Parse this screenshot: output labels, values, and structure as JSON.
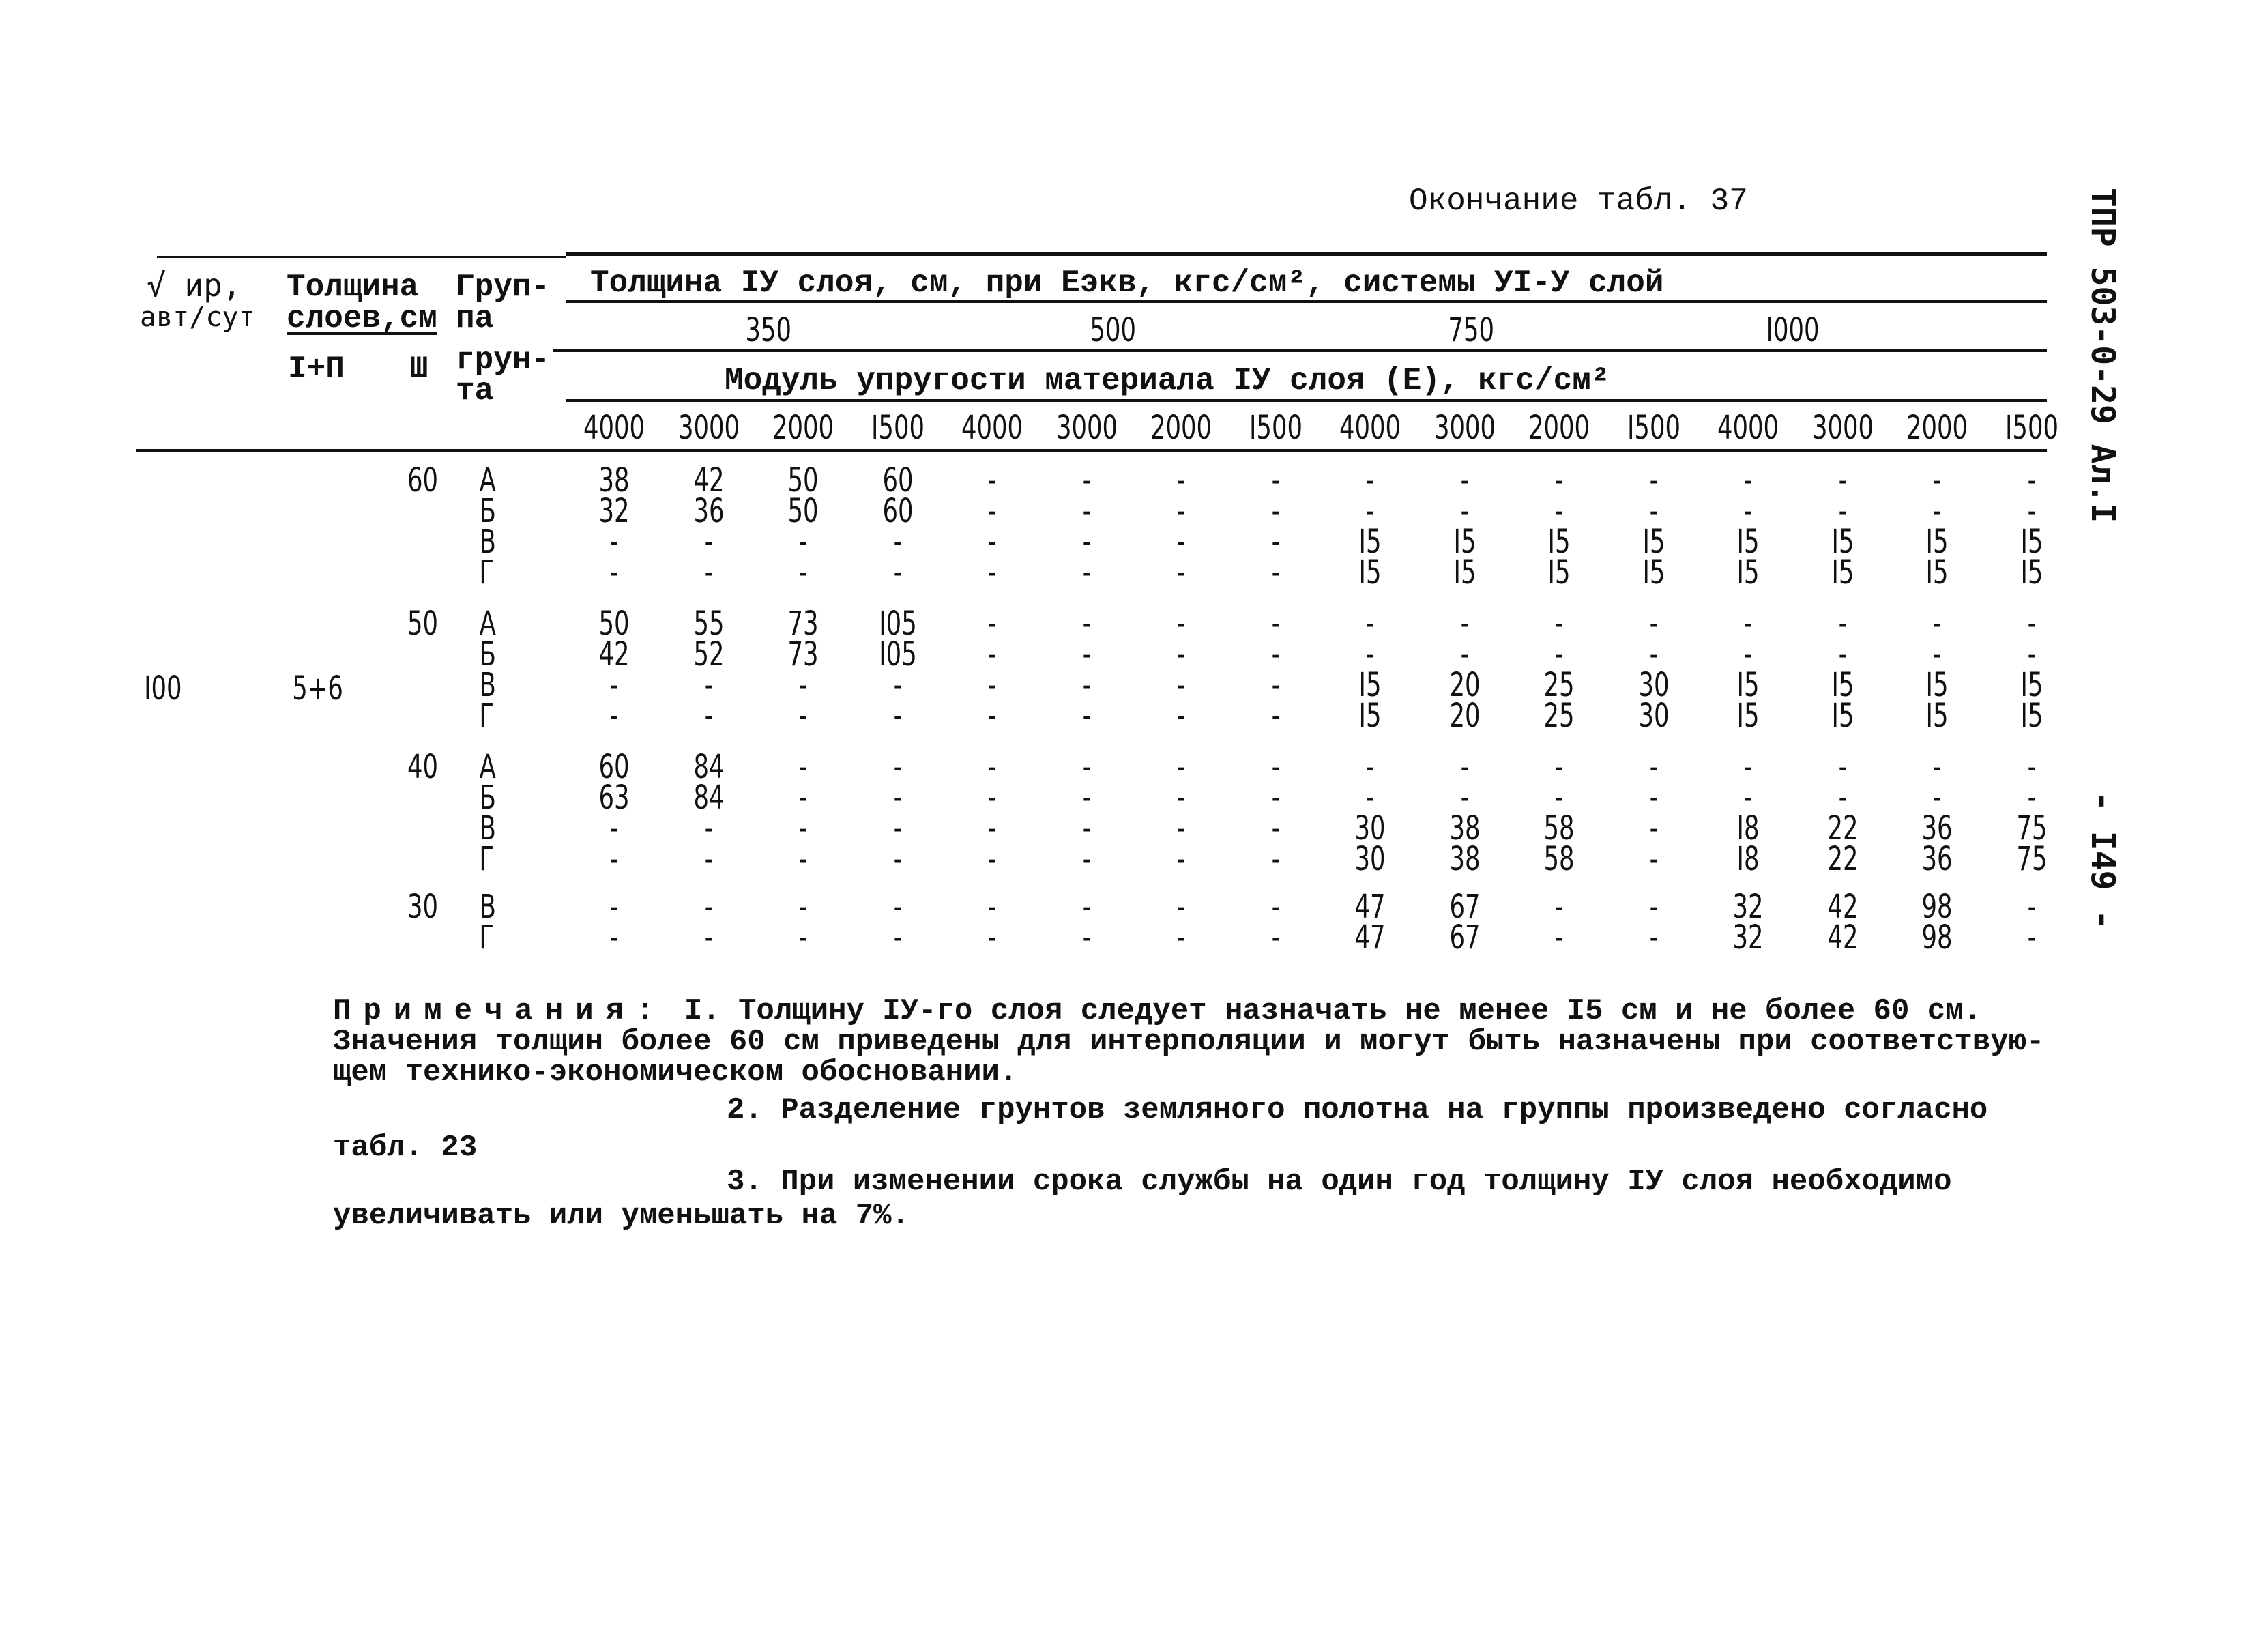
{
  "page": {
    "continuation_title": "Окончание табл. 37",
    "side_code": "ТПР 503-0-29 Ал.I",
    "page_number": "- I49 -"
  },
  "table": {
    "header": {
      "col_traffic": [
        "√ ир,",
        "авт/сут"
      ],
      "col_thickness": {
        "title": "Толщина",
        "title2": "слоев,см",
        "sub1": "I+П",
        "sub2": "Ш"
      },
      "col_group": [
        "Груп-",
        "па",
        "грун-",
        "та"
      ],
      "span_title": "Толщина IУ слоя, см, при Еэкв, кгс/см², системы УI-У слой",
      "eekv_values": [
        "350",
        "500",
        "750",
        "I000"
      ],
      "modulus_title": "Модуль упругости материала IУ слоя (Е), кгс/см²",
      "modulus_values": [
        "4000",
        "3000",
        "2000",
        "I500",
        "4000",
        "3000",
        "2000",
        "I500",
        "4000",
        "3000",
        "2000",
        "I500",
        "4000",
        "3000",
        "2000",
        "I500"
      ]
    },
    "traffic_value": "I00",
    "layers_value": "5+6",
    "blocks": [
      {
        "layer3": "60",
        "rows": [
          {
            "group": "А",
            "values": [
              "38",
              "42",
              "50",
              "60",
              "-",
              "-",
              "-",
              "-",
              "-",
              "-",
              "-",
              "-",
              "-",
              "-",
              "-",
              "-"
            ]
          },
          {
            "group": "Б",
            "values": [
              "32",
              "36",
              "50",
              "60",
              "-",
              "-",
              "-",
              "-",
              "-",
              "-",
              "-",
              "-",
              "-",
              "-",
              "-",
              "-"
            ]
          },
          {
            "group": "В",
            "values": [
              "-",
              "-",
              "-",
              "-",
              "-",
              "-",
              "-",
              "-",
              "I5",
              "I5",
              "I5",
              "I5",
              "I5",
              "I5",
              "I5",
              "I5"
            ]
          },
          {
            "group": "Г",
            "values": [
              "-",
              "-",
              "-",
              "-",
              "-",
              "-",
              "-",
              "-",
              "I5",
              "I5",
              "I5",
              "I5",
              "I5",
              "I5",
              "I5",
              "I5"
            ]
          }
        ]
      },
      {
        "layer3": "50",
        "rows": [
          {
            "group": "А",
            "values": [
              "50",
              "55",
              "73",
              "I05",
              "-",
              "-",
              "-",
              "-",
              "-",
              "-",
              "-",
              "-",
              "-",
              "-",
              "-",
              "-"
            ]
          },
          {
            "group": "Б",
            "values": [
              "42",
              "52",
              "73",
              "I05",
              "-",
              "-",
              "-",
              "-",
              "-",
              "-",
              "-",
              "-",
              "-",
              "-",
              "-",
              "-"
            ]
          },
          {
            "group": "В",
            "values": [
              "-",
              "-",
              "-",
              "-",
              "-",
              "-",
              "-",
              "-",
              "I5",
              "20",
              "25",
              "30",
              "I5",
              "I5",
              "I5",
              "I5"
            ]
          },
          {
            "group": "Г",
            "values": [
              "-",
              "-",
              "-",
              "-",
              "-",
              "-",
              "-",
              "-",
              "I5",
              "20",
              "25",
              "30",
              "I5",
              "I5",
              "I5",
              "I5"
            ]
          }
        ]
      },
      {
        "layer3": "40",
        "rows": [
          {
            "group": "А",
            "values": [
              "60",
              "84",
              "-",
              "-",
              "-",
              "-",
              "-",
              "-",
              "-",
              "-",
              "-",
              "-",
              "-",
              "-",
              "-",
              "-"
            ]
          },
          {
            "group": "Б",
            "values": [
              "63",
              "84",
              "-",
              "-",
              "-",
              "-",
              "-",
              "-",
              "-",
              "-",
              "-",
              "-",
              "-",
              "-",
              "-",
              "-"
            ]
          },
          {
            "group": "В",
            "values": [
              "-",
              "-",
              "-",
              "-",
              "-",
              "-",
              "-",
              "-",
              "30",
              "38",
              "58",
              "-",
              "I8",
              "22",
              "36",
              "75"
            ]
          },
          {
            "group": "Г",
            "values": [
              "-",
              "-",
              "-",
              "-",
              "-",
              "-",
              "-",
              "-",
              "30",
              "38",
              "58",
              "-",
              "I8",
              "22",
              "36",
              "75"
            ]
          }
        ]
      },
      {
        "layer3": "30",
        "rows": [
          {
            "group": "В",
            "values": [
              "-",
              "-",
              "-",
              "-",
              "-",
              "-",
              "-",
              "-",
              "47",
              "67",
              "-",
              "-",
              "32",
              "42",
              "98",
              "-"
            ]
          },
          {
            "group": "Г",
            "values": [
              "-",
              "-",
              "-",
              "-",
              "-",
              "-",
              "-",
              "-",
              "47",
              "67",
              "-",
              "-",
              "32",
              "42",
              "98",
              "-"
            ]
          }
        ]
      }
    ]
  },
  "notes": {
    "label": "Примечания:",
    "lines": [
      " I. Толщину IУ-го слоя следует назначать не менее I5 см и не более 60 см.",
      "Значения толщин более 60 см приведены для интерполяции и могут быть назначены при соответствую-",
      "щем технико-экономическом обосновании.",
      "2. Разделение грунтов земляного полотна на группы произведено согласно",
      "табл. 23",
      "3. При изменении срока службы на один год толщину IУ слоя необходимо",
      "увеличивать или уменьшать на 7%."
    ]
  }
}
